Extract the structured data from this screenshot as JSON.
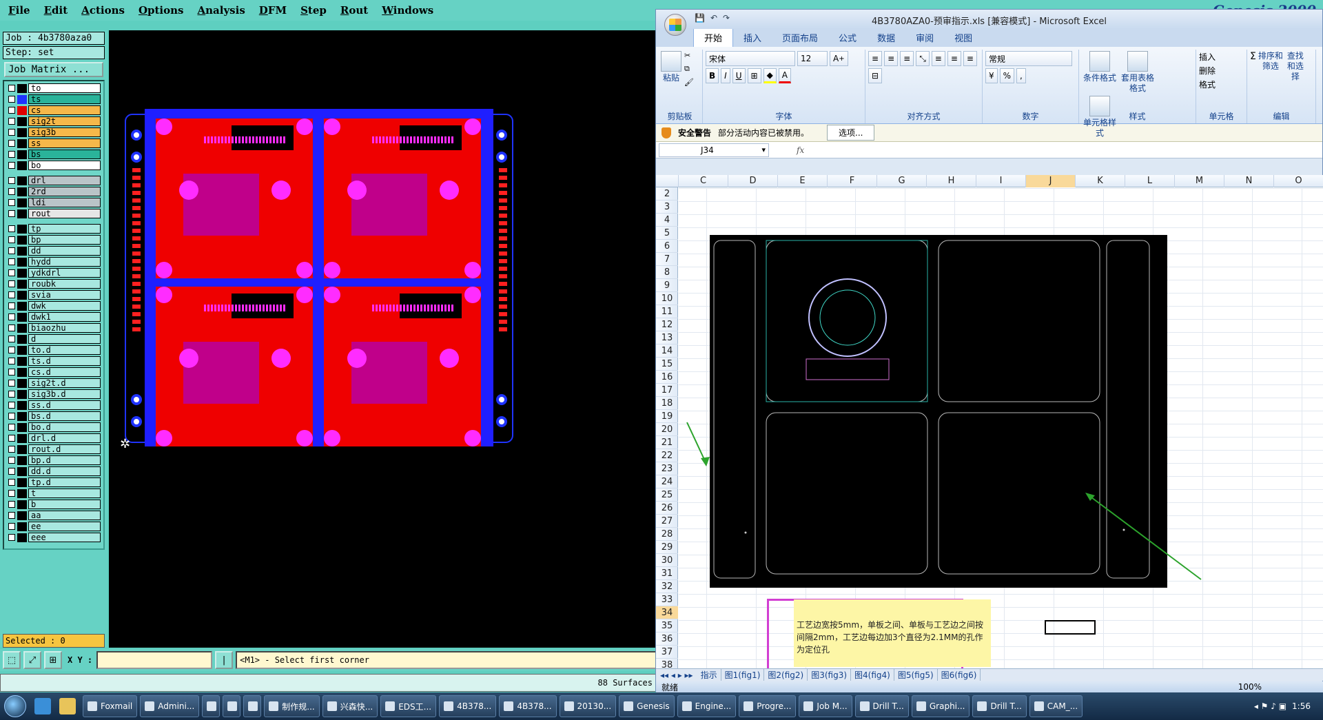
{
  "genesis": {
    "menu": [
      "File",
      "Edit",
      "Actions",
      "Options",
      "Analysis",
      "DFM",
      "Step",
      "Rout",
      "Windows"
    ],
    "brand": "Genesis 2000",
    "job": "Job : 4b3780aza0",
    "step": "Step: set",
    "job_matrix_button": "Job Matrix ...",
    "layer_groups": [
      [
        {
          "name": "to",
          "color": "#ffffff",
          "swatch": "#000000"
        },
        {
          "name": "ts",
          "color": "#2ab39a",
          "swatch": "#1f33ff"
        },
        {
          "name": "cs",
          "color": "#f6b84a",
          "swatch": "#e00000"
        },
        {
          "name": "sig2t",
          "color": "#f6b84a",
          "swatch": "#000000"
        },
        {
          "name": "sig3b",
          "color": "#f6b84a",
          "swatch": "#000000"
        },
        {
          "name": "ss",
          "color": "#f6b84a",
          "swatch": "#000000"
        },
        {
          "name": "bs",
          "color": "#2ab39a",
          "swatch": "#000000"
        },
        {
          "name": "bo",
          "color": "#ffffff",
          "swatch": "#000000"
        }
      ],
      [
        {
          "name": "drl",
          "color": "#b9c4c8",
          "swatch": "#000000"
        },
        {
          "name": "2rd",
          "color": "#b9c4c8",
          "swatch": "#000000"
        },
        {
          "name": "ldi",
          "color": "#b9c4c8",
          "swatch": "#000000"
        },
        {
          "name": "rout",
          "color": "#e6e6e6",
          "swatch": "#000000"
        }
      ],
      [
        {
          "name": "tp",
          "color": "#a8e8e0",
          "swatch": "#000000"
        },
        {
          "name": "bp",
          "color": "#a8e8e0",
          "swatch": "#000000"
        },
        {
          "name": "dd",
          "color": "#a8e8e0",
          "swatch": "#000000"
        },
        {
          "name": "hydd",
          "color": "#a8e8e0",
          "swatch": "#000000"
        },
        {
          "name": "ydkdrl",
          "color": "#a8e8e0",
          "swatch": "#000000"
        },
        {
          "name": "roubk",
          "color": "#a8e8e0",
          "swatch": "#000000"
        },
        {
          "name": "svia",
          "color": "#a8e8e0",
          "swatch": "#000000"
        },
        {
          "name": "dwk",
          "color": "#a8e8e0",
          "swatch": "#000000"
        },
        {
          "name": "dwk1",
          "color": "#a8e8e0",
          "swatch": "#000000"
        },
        {
          "name": "biaozhu",
          "color": "#a8e8e0",
          "swatch": "#000000"
        },
        {
          "name": "d",
          "color": "#a8e8e0",
          "swatch": "#000000"
        },
        {
          "name": "to.d",
          "color": "#a8e8e0",
          "swatch": "#000000"
        },
        {
          "name": "ts.d",
          "color": "#a8e8e0",
          "swatch": "#000000"
        },
        {
          "name": "cs.d",
          "color": "#a8e8e0",
          "swatch": "#000000"
        },
        {
          "name": "sig2t.d",
          "color": "#a8e8e0",
          "swatch": "#000000"
        },
        {
          "name": "sig3b.d",
          "color": "#a8e8e0",
          "swatch": "#000000"
        },
        {
          "name": "ss.d",
          "color": "#a8e8e0",
          "swatch": "#000000"
        },
        {
          "name": "bs.d",
          "color": "#a8e8e0",
          "swatch": "#000000"
        },
        {
          "name": "bo.d",
          "color": "#a8e8e0",
          "swatch": "#000000"
        },
        {
          "name": "drl.d",
          "color": "#a8e8e0",
          "swatch": "#000000"
        },
        {
          "name": "rout.d",
          "color": "#a8e8e0",
          "swatch": "#000000"
        },
        {
          "name": "bp.d",
          "color": "#a8e8e0",
          "swatch": "#000000"
        },
        {
          "name": "dd.d",
          "color": "#a8e8e0",
          "swatch": "#000000"
        },
        {
          "name": "tp.d",
          "color": "#a8e8e0",
          "swatch": "#000000"
        },
        {
          "name": "t",
          "color": "#a8e8e0",
          "swatch": "#000000"
        },
        {
          "name": "b",
          "color": "#a8e8e0",
          "swatch": "#000000"
        },
        {
          "name": "aa",
          "color": "#a8e8e0",
          "swatch": "#000000"
        },
        {
          "name": "ee",
          "color": "#a8e8e0",
          "swatch": "#000000"
        },
        {
          "name": "eee",
          "color": "#a8e8e0",
          "swatch": "#000000"
        }
      ]
    ],
    "selected": "Selected : 0",
    "xy_label": "X Y :",
    "prompt": "<M1> - Select first corner",
    "status": "88 Surfaces"
  },
  "excel": {
    "window_title": "4B3780AZA0-预审指示.xls [兼容模式] - Microsoft Excel",
    "tabs": [
      "开始",
      "插入",
      "页面布局",
      "公式",
      "数据",
      "审阅",
      "视图"
    ],
    "ribbon": {
      "clipboard": {
        "label": "剪贴板",
        "paste": "粘贴"
      },
      "font": {
        "label": "字体",
        "name": "宋体",
        "size": "12"
      },
      "align": {
        "label": "对齐方式"
      },
      "number": {
        "label": "数字",
        "format": "常规"
      },
      "styles": {
        "label": "样式",
        "cond": "条件格式",
        "table": "套用表格格式",
        "cell": "单元格样式"
      },
      "cells": {
        "label": "单元格",
        "insert": "插入",
        "delete": "删除",
        "format": "格式"
      },
      "edit": {
        "label": "编辑",
        "sort": "排序和筛选",
        "find": "查找和选择"
      }
    },
    "security": {
      "title": "安全警告",
      "message": "部分活动内容已被禁用。",
      "button": "选项..."
    },
    "name_box": "J34",
    "fx": "fx",
    "columns": [
      "C",
      "D",
      "E",
      "F",
      "G",
      "H",
      "I",
      "J",
      "K",
      "L",
      "M",
      "N",
      "O"
    ],
    "selected_column": "J",
    "rows": [
      "2",
      "3",
      "4",
      "5",
      "6",
      "7",
      "8",
      "9",
      "10",
      "11",
      "12",
      "13",
      "14",
      "15",
      "16",
      "17",
      "18",
      "19",
      "20",
      "21",
      "22",
      "23",
      "24",
      "25",
      "26",
      "27",
      "28",
      "29",
      "30",
      "31",
      "32",
      "33",
      "34",
      "35",
      "36",
      "37",
      "38"
    ],
    "selected_row": "34",
    "note": "工艺边宽按5mm，单板之间、单板与工艺边之间按间隔2mm，工艺边每边加3个直径为2.1MM的孔作为定位孔",
    "sheets": [
      "指示",
      "图1(fig1)",
      "图2(fig2)",
      "图3(fig3)",
      "图4(fig4)",
      "图5(fig5)",
      "图6(fig6)"
    ],
    "status": "就绪",
    "zoom": "100%"
  },
  "taskbar": {
    "buttons": [
      "Foxmail",
      "Admini...",
      "",
      "",
      "",
      "制作规...",
      "兴森快...",
      "EDS工...",
      "4B378...",
      "4B378...",
      "20130...",
      "Genesis",
      "Engine...",
      "Progre...",
      "Job M...",
      "Drill T...",
      "Graphi...",
      "Drill T...",
      "CAM_..."
    ],
    "time": "1:56"
  }
}
